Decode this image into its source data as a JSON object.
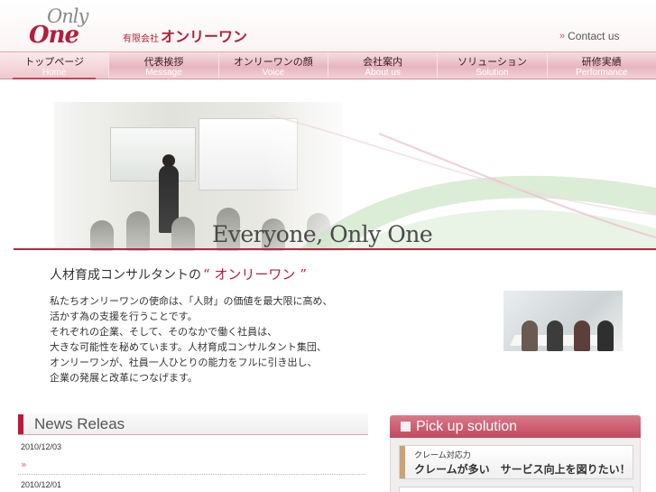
{
  "header": {
    "logo_only": "Only",
    "logo_one": "One",
    "company_prefix": "有限会社",
    "company_name": "オンリーワン",
    "contact_label": "Contact us"
  },
  "nav": {
    "items": [
      {
        "jp": "トップページ",
        "en": "Home"
      },
      {
        "jp": "代表挨拶",
        "en": "Message"
      },
      {
        "jp": "オンリーワンの顔",
        "en": "Voice"
      },
      {
        "jp": "会社案内",
        "en": "About us"
      },
      {
        "jp": "ソリューション",
        "en": "Solution"
      },
      {
        "jp": "研修実績",
        "en": "Performance"
      }
    ],
    "active_index": 0
  },
  "hero": {
    "tagline": "Everyone, Only One"
  },
  "intro": {
    "title_prefix": "人材育成コンサルタントの",
    "title_brand": "“ オンリーワン ”",
    "lines": [
      "私たちオンリーワンの使命は、「人財」の価値を最大限に高め、",
      "活かす為の支援を行うことです。",
      "それぞれの企業、そして、そのなかで働く社員は、",
      "大きな可能性を秘めています。人材育成コンサルタント集団、",
      "オンリーワンが、社員一人ひとりの能力をフルに引き出し、",
      "企業の発展と改革につなげます。"
    ]
  },
  "news": {
    "title": "News Releas",
    "items": [
      {
        "date": "2010/12/03",
        "text": ""
      },
      {
        "date": "2010/12/01",
        "text": ""
      }
    ]
  },
  "pickup": {
    "title": "Pick up solution",
    "cards": [
      {
        "small": "クレーム対応力",
        "big": "クレームが多い　サービス向上を図りたい！"
      }
    ]
  },
  "colors": {
    "brand": "#b21e3a",
    "nav_pink": "#e7b5bf",
    "pickup_header": "#c24a60"
  }
}
